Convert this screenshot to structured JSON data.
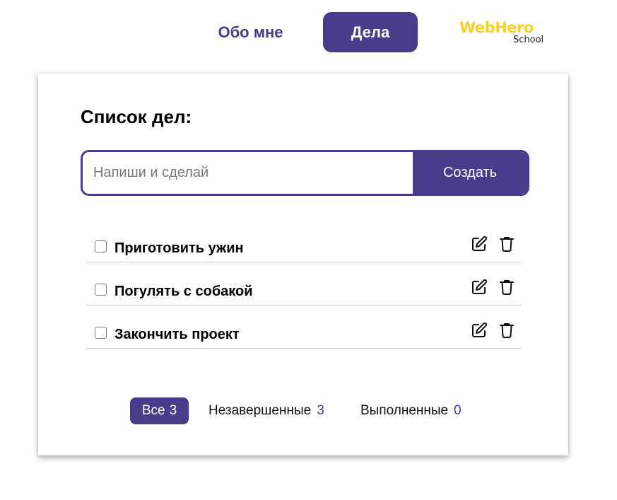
{
  "nav": {
    "about_label": "Обо мне",
    "tasks_label": "Дела"
  },
  "logo": {
    "main": "WebHero",
    "sub": "School",
    "color": "#f8d024"
  },
  "card": {
    "title": "Список дел:"
  },
  "form": {
    "placeholder": "Напиши и сделай",
    "value": "",
    "submit_label": "Создать"
  },
  "tasks": [
    {
      "label": "Приготовить ужин",
      "done": false
    },
    {
      "label": "Погулять с собакой",
      "done": false
    },
    {
      "label": "Закончить проект",
      "done": false
    }
  ],
  "icons": {
    "edit": "edit-icon",
    "delete": "trash-icon"
  },
  "filters": {
    "all": {
      "label": "Все",
      "count": "3"
    },
    "active": {
      "label": "Незавершенные",
      "count": "3"
    },
    "done": {
      "label": "Выполненные",
      "count": "0"
    }
  },
  "colors": {
    "accent": "#483d8b",
    "logo_yellow": "#f8d024",
    "divider": "#c9c9c9"
  }
}
